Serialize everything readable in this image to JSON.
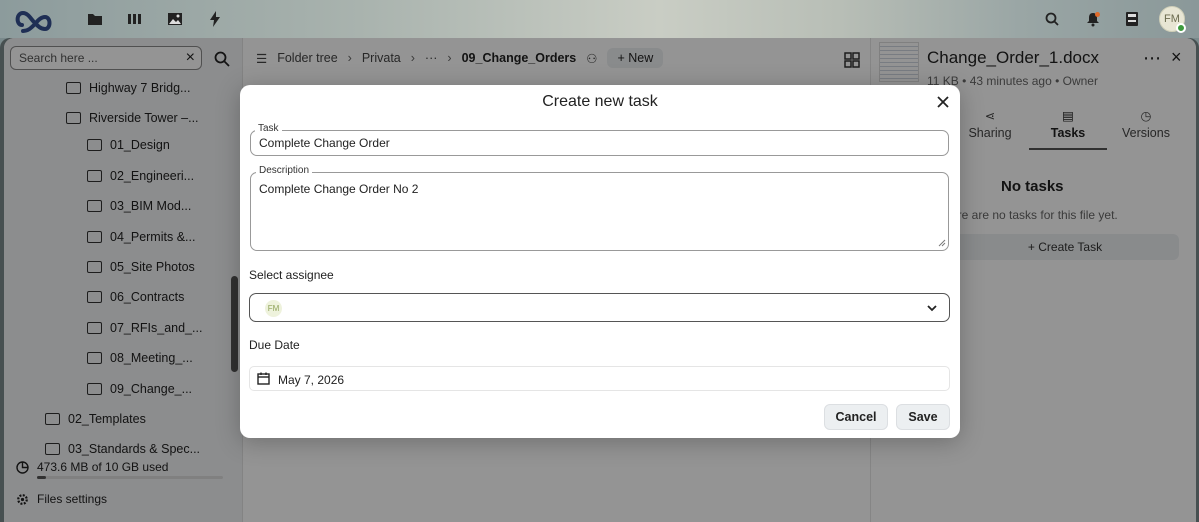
{
  "topbar": {
    "icons": [
      "files-icon",
      "apps-icon",
      "photos-icon",
      "activity-icon",
      "search-icon",
      "notifications-icon",
      "contacts-icon"
    ],
    "avatar_initials": "FM"
  },
  "sidebar": {
    "search_placeholder": "Search here ...",
    "items": [
      {
        "label": "Highway 7 Bridg..."
      },
      {
        "label": "Riverside Tower –..."
      },
      {
        "label": "01_Design"
      },
      {
        "label": "02_Engineeri..."
      },
      {
        "label": "03_BIM Mod..."
      },
      {
        "label": "04_Permits &..."
      },
      {
        "label": "05_Site Photos"
      },
      {
        "label": "06_Contracts"
      },
      {
        "label": "07_RFIs_and_..."
      },
      {
        "label": "08_Meeting_..."
      },
      {
        "label": "09_Change_..."
      },
      {
        "label": "02_Templates"
      },
      {
        "label": "03_Standards & Spec..."
      }
    ],
    "storage": "473.6 MB of 10 GB used",
    "storage_fraction": 0.047,
    "settings": "Files settings"
  },
  "breadcrumbs": {
    "folder_tree": "Folder tree",
    "privata": "Privata",
    "ellipsis": "···",
    "current": "09_Change_Orders",
    "new": "New"
  },
  "rightpanel": {
    "title": "Change_Order_1.docx",
    "size": "11 KB",
    "time": "43 minutes ago",
    "owner": "Owner",
    "tabs": [
      {
        "label": "Sharing"
      },
      {
        "label": "Tasks"
      },
      {
        "label": "Versions"
      }
    ],
    "no_tasks": "No tasks",
    "sub": "ere are no tasks for this file yet.",
    "create": "+ Create Task"
  },
  "modal": {
    "title": "Create new task",
    "task_label": "Task",
    "task_value": "Complete Change Order",
    "desc_label": "Description",
    "desc_value": "Complete Change Order No 2",
    "assignee_label": "Select assignee",
    "assignee_initials": "FM",
    "due_label": "Due Date",
    "due_value": "May 7, 2026",
    "cancel": "Cancel",
    "save": "Save"
  }
}
